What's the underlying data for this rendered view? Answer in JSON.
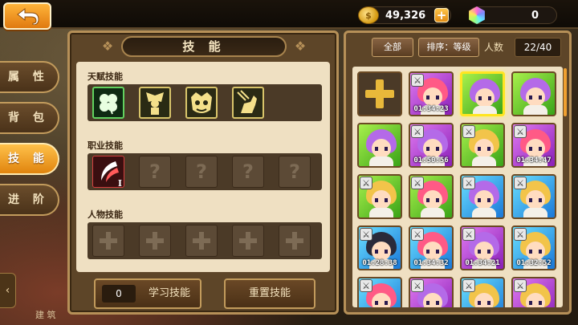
{
  "currency": {
    "gold": "49,326",
    "gems": "0"
  },
  "side_tabs": [
    {
      "label": "属 性",
      "active": false
    },
    {
      "label": "背 包",
      "active": false
    },
    {
      "label": "技 能",
      "active": true
    },
    {
      "label": "进 阶",
      "active": false
    }
  ],
  "building_label": "建 筑",
  "skills": {
    "title": "技 能",
    "talent_label": "天赋技能",
    "job_label": "职业技能",
    "char_label": "人物技能",
    "talent_icons": [
      "clover-icon",
      "angel-icon",
      "mask-icon",
      "horse-icon"
    ],
    "job_level": "I",
    "learn_count": "0",
    "learn_button": "学习技能",
    "reset_button": "重置技能"
  },
  "heroes": {
    "filter_all": "全部",
    "filter_sort": "排序：等级",
    "count_label": "人数",
    "count": "22/40",
    "cards": [
      {
        "type": "add"
      },
      {
        "bg": "p",
        "hair": "pink",
        "sword": true,
        "timer": "01:34:23"
      },
      {
        "bg": "g",
        "hair": "violet",
        "sword": false,
        "timer": "",
        "selected": true
      },
      {
        "bg": "g",
        "hair": "violet",
        "sword": false,
        "timer": ""
      },
      {
        "bg": "g",
        "hair": "violet",
        "sword": false,
        "timer": ""
      },
      {
        "bg": "p",
        "hair": "violet",
        "sword": true,
        "timer": "01:50:56"
      },
      {
        "bg": "g",
        "hair": "blond",
        "sword": true,
        "timer": ""
      },
      {
        "bg": "p",
        "hair": "pink",
        "sword": true,
        "timer": "01:34:47"
      },
      {
        "bg": "g",
        "hair": "blond",
        "sword": true,
        "timer": ""
      },
      {
        "bg": "g",
        "hair": "pink",
        "sword": true,
        "timer": ""
      },
      {
        "bg": "b",
        "hair": "violet",
        "sword": true,
        "timer": ""
      },
      {
        "bg": "b",
        "hair": "blond",
        "sword": true,
        "timer": ""
      },
      {
        "bg": "b",
        "hair": "dark",
        "sword": true,
        "timer": "01:28:38"
      },
      {
        "bg": "b",
        "hair": "pink",
        "sword": true,
        "timer": "01:34:32"
      },
      {
        "bg": "p",
        "hair": "violet",
        "sword": true,
        "timer": "01:34:21"
      },
      {
        "bg": "b",
        "hair": "blond",
        "sword": true,
        "timer": "01:32:52"
      },
      {
        "bg": "b",
        "hair": "pink",
        "sword": true,
        "timer": ""
      },
      {
        "bg": "p",
        "hair": "violet",
        "sword": true,
        "timer": ""
      },
      {
        "bg": "b",
        "hair": "blond",
        "sword": true,
        "timer": ""
      },
      {
        "bg": "p",
        "hair": "blond",
        "sword": true,
        "timer": ""
      }
    ]
  }
}
